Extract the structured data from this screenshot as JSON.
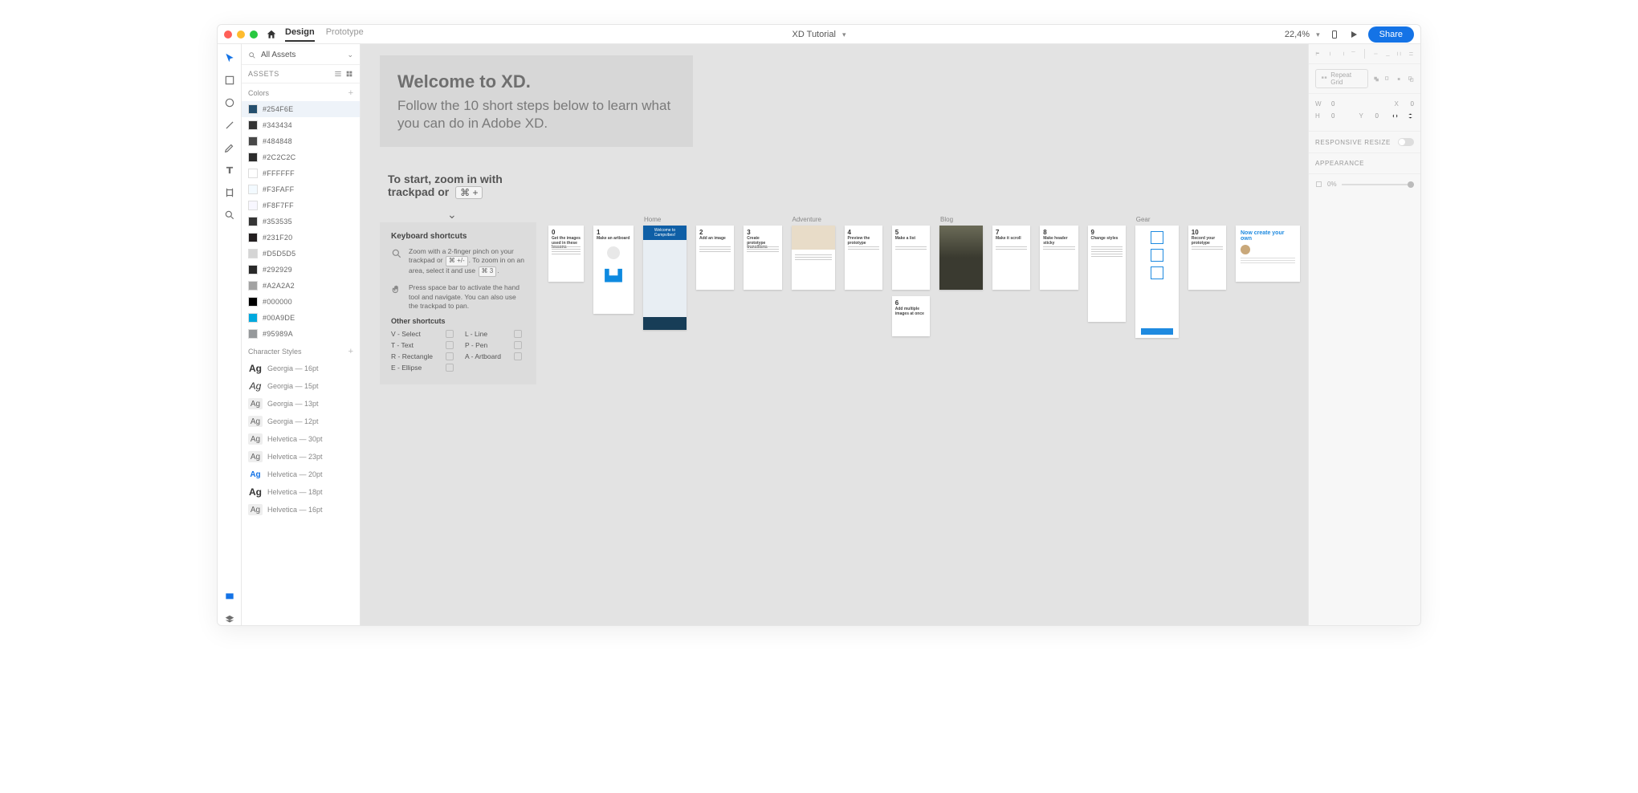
{
  "menubar": {
    "tabs": {
      "design": "Design",
      "prototype": "Prototype"
    },
    "doc_title": "XD Tutorial",
    "zoom": "22,4%",
    "share": "Share"
  },
  "assets": {
    "search_label": "All Assets",
    "heading": "ASSETS",
    "colors_title": "Colors",
    "colors": [
      {
        "hex": "#254F6E",
        "sel": true
      },
      {
        "hex": "#343434"
      },
      {
        "hex": "#484848"
      },
      {
        "hex": "#2C2C2C"
      },
      {
        "hex": "#FFFFFF"
      },
      {
        "hex": "#F3FAFF"
      },
      {
        "hex": "#F8F7FF"
      },
      {
        "hex": "#353535"
      },
      {
        "hex": "#231F20"
      },
      {
        "hex": "#D5D5D5"
      },
      {
        "hex": "#292929"
      },
      {
        "hex": "#A2A2A2"
      },
      {
        "hex": "#000000"
      },
      {
        "hex": "#00A9DE"
      },
      {
        "hex": "#95989A"
      }
    ],
    "char_title": "Character Styles",
    "char_styles": [
      {
        "label": "Georgia — 16pt",
        "kind": "big"
      },
      {
        "label": "Georgia — 15pt",
        "kind": "it"
      },
      {
        "label": "Georgia — 13pt",
        "kind": "sm"
      },
      {
        "label": "Georgia — 12pt",
        "kind": "sm"
      },
      {
        "label": "Helvetica — 30pt",
        "kind": "sm"
      },
      {
        "label": "Helvetica — 23pt",
        "kind": "sm"
      },
      {
        "label": "Helvetica — 20pt",
        "kind": "blue"
      },
      {
        "label": "Helvetica — 18pt",
        "kind": "big"
      },
      {
        "label": "Helvetica — 16pt",
        "kind": "sm"
      }
    ]
  },
  "canvas": {
    "welcome_title": "Welcome to XD.",
    "welcome_body": "Follow the 10 short steps below to learn what you can do in Adobe XD.",
    "start_l1": "To start, zoom in with",
    "start_l2": "trackpad or",
    "start_kbd": "⌘ +",
    "shortcuts": {
      "title": "Keyboard shortcuts",
      "zoom_a": "Zoom with a 2-finger pinch on your trackpad or ",
      "zoom_k1": "⌘ +/-",
      "zoom_b": ". To zoom in on an area, select it and use ",
      "zoom_k2": "⌘ 3",
      "zoom_c": ".",
      "pan": "Press space bar to activate the hand tool and navigate. You can also use the trackpad to pan.",
      "other_title": "Other shortcuts",
      "grid": [
        [
          "V - Select",
          "L - Line"
        ],
        [
          "T - Text",
          "P - Pen"
        ],
        [
          "R - Rectangle",
          "A - Artboard"
        ],
        [
          "E - Ellipse",
          ""
        ]
      ]
    },
    "labels": {
      "home": "Home",
      "adventure": "Adventure",
      "blog": "Blog",
      "gear": "Gear"
    },
    "steps": {
      "s0": {
        "n": "0",
        "t": "Get the images used in these lessons"
      },
      "s1": {
        "n": "1",
        "t": "Make an artboard"
      },
      "s2": {
        "n": "2",
        "t": "Add an image"
      },
      "s3": {
        "n": "3",
        "t": "Create prototype transitions"
      },
      "s4": {
        "n": "4",
        "t": "Preview the prototype"
      },
      "s5": {
        "n": "5",
        "t": "Make a list"
      },
      "s6": {
        "n": "6",
        "t": "Add multiple images at once"
      },
      "s7": {
        "n": "7",
        "t": "Make it scroll"
      },
      "s8": {
        "n": "8",
        "t": "Make header sticky"
      },
      "s9": {
        "n": "9",
        "t": "Change styles"
      },
      "s10": {
        "n": "10",
        "t": "Record your prototype"
      }
    },
    "home_hdr": "Welcome to Campvibes!",
    "now_title": "Now create your own"
  },
  "right": {
    "repeat": "Repeat Grid",
    "dims": {
      "w": "W",
      "wval": "0",
      "x": "X",
      "xval": "0",
      "h": "H",
      "hval": "0",
      "y": "Y",
      "yval": "0"
    },
    "responsive": "RESPONSIVE RESIZE",
    "appearance": "APPEARANCE",
    "opacity": "0%"
  }
}
